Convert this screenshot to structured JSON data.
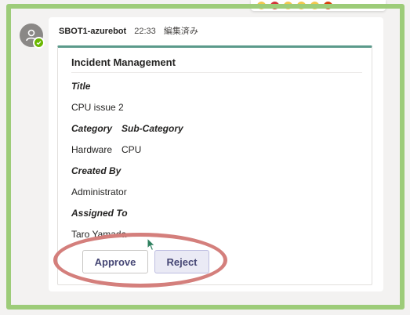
{
  "message": {
    "sender": "SBOT1-azurebot",
    "time": "22:33",
    "edited_label": "編集済み"
  },
  "card": {
    "title": "Incident Management",
    "title_label": "Title",
    "title_value": "CPU issue 2",
    "category_label": "Category",
    "subcategory_label": "Sub-Category",
    "category_value": "Hardware",
    "subcategory_value": "CPU",
    "created_by_label": "Created By",
    "created_by_value": "Administrator",
    "assigned_to_label": "Assigned To",
    "assigned_to_value": "Taro Yamada"
  },
  "actions": {
    "approve_label": "Approve",
    "reject_label": "Reject"
  },
  "colors": {
    "card_accent": "#5b9a8b",
    "highlight_frame": "#9dcc79",
    "annotation_ellipse": "#d47f7c",
    "button_text": "#464775"
  },
  "icons": {
    "avatar": "bot-person-icon",
    "presence": "available-check-icon",
    "reactions": [
      "like-icon",
      "heart-icon",
      "laugh-icon",
      "surprised-icon",
      "sad-icon",
      "angry-icon",
      "more-options-icon"
    ]
  }
}
